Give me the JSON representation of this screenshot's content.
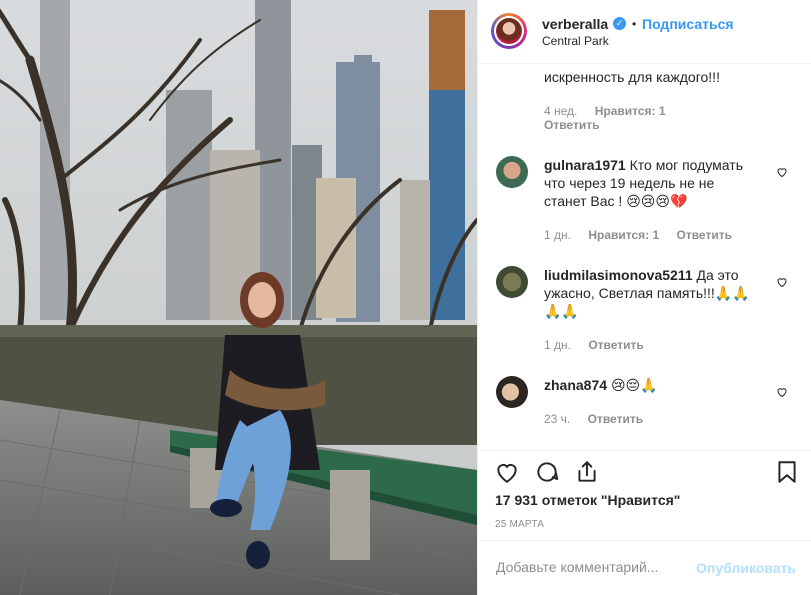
{
  "header": {
    "username": "verberalla",
    "follow_label": "Подписаться",
    "location": "Central Park"
  },
  "comments": [
    {
      "id": "c0",
      "text": "искренность для каждого!!!",
      "time": "4 нед.",
      "likes": "Нравится: 1",
      "reply": "Ответить"
    },
    {
      "id": "c1",
      "user": "gulnara1971",
      "text": "Кто мог подумать что через 19 недель не не станет Вас ! 😢😢😢💔",
      "time": "1 дн.",
      "likes": "Нравится: 1",
      "reply": "Ответить"
    },
    {
      "id": "c2",
      "user": "liudmilasimonova5211",
      "text": "Да это ужасно, Светлая память!!!🙏🙏🙏🙏",
      "time": "1 дн.",
      "reply": "Ответить"
    },
    {
      "id": "c3",
      "user": "zhana874",
      "text": "😢😔🙏",
      "time": "23 ч.",
      "reply": "Ответить"
    }
  ],
  "post": {
    "likes_label": "17 931 отметок \"Нравится\"",
    "date": "25 МАРТА"
  },
  "add_comment": {
    "placeholder": "Добавьте комментарий...",
    "publish_label": "Опубликовать"
  },
  "icons": {
    "like": "heart-icon",
    "comment": "comment-icon",
    "share": "share-icon",
    "save": "bookmark-icon"
  },
  "colors": {
    "link": "#3897f0",
    "muted": "#8e8e8e",
    "publish_disabled": "#b2dffc"
  }
}
